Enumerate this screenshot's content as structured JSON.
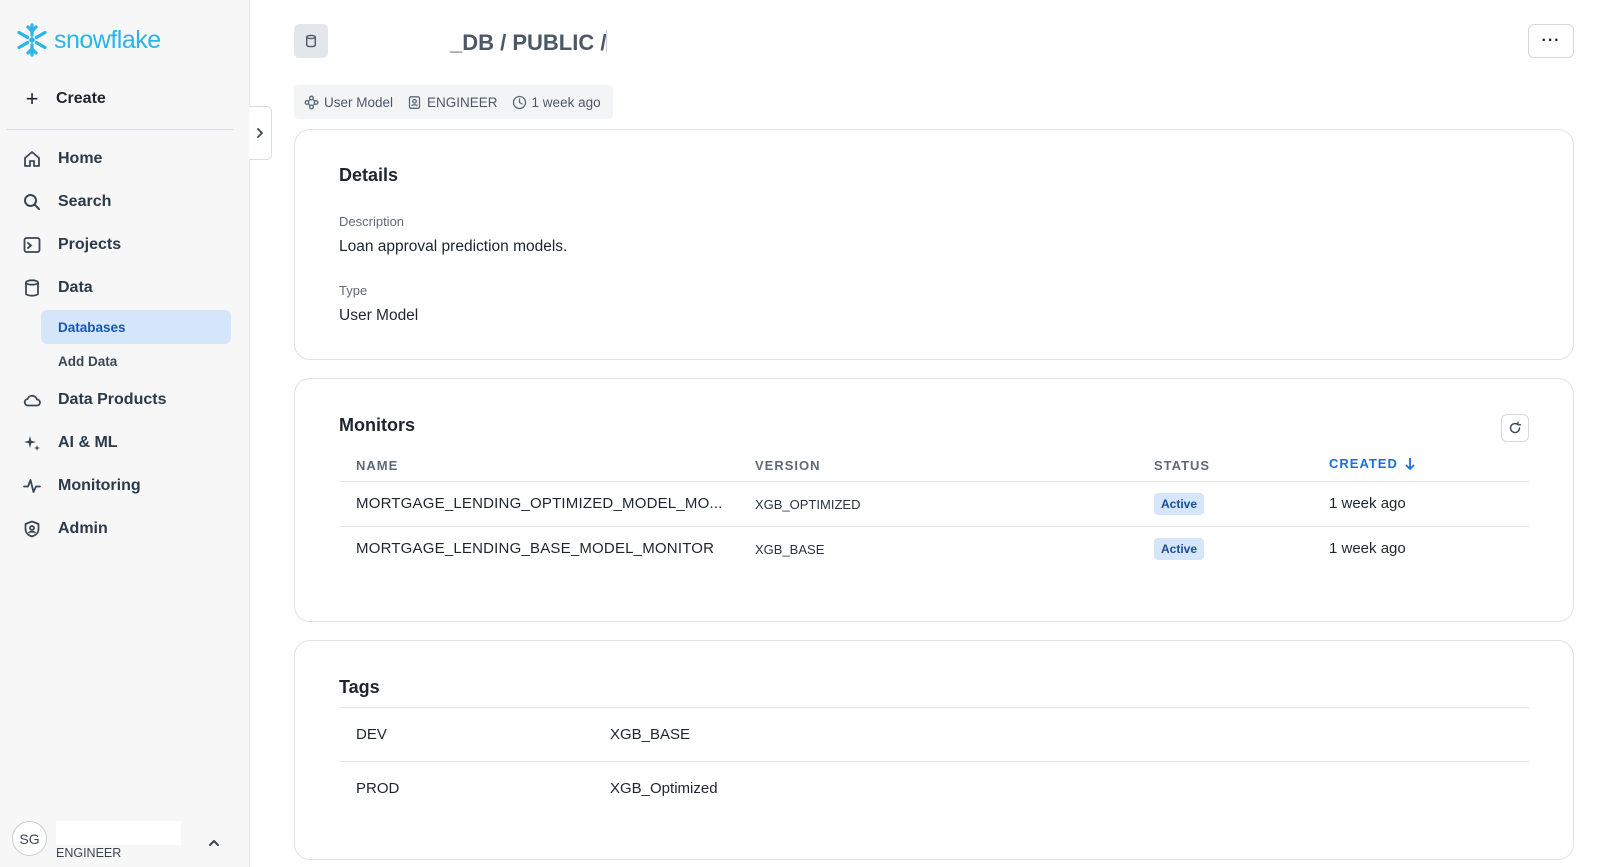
{
  "brand": {
    "logo_text": "snowflake",
    "logo_color": "#29b5e8"
  },
  "sidebar": {
    "create_label": "Create",
    "nav": [
      {
        "label": "Home",
        "icon": "home-icon"
      },
      {
        "label": "Search",
        "icon": "search-icon"
      },
      {
        "label": "Projects",
        "icon": "terminal-icon"
      },
      {
        "label": "Data",
        "icon": "database-icon"
      },
      {
        "label": "Data Products",
        "icon": "cloud-icon"
      },
      {
        "label": "AI & ML",
        "icon": "sparkle-icon"
      },
      {
        "label": "Monitoring",
        "icon": "activity-icon"
      },
      {
        "label": "Admin",
        "icon": "shield-icon"
      }
    ],
    "data_sub": [
      {
        "label": "Databases",
        "active": true
      },
      {
        "label": "Add Data",
        "active": false
      }
    ],
    "user": {
      "initials": "SG",
      "role": "ENGINEER"
    }
  },
  "header": {
    "breadcrumb": "_DB / PUBLIC /",
    "more_label": "···"
  },
  "meta": {
    "type": "User Model",
    "owner": "ENGINEER",
    "created": "1 week ago"
  },
  "details": {
    "title": "Details",
    "description_label": "Description",
    "description": "Loan approval prediction models.",
    "type_label": "Type",
    "type": "User Model"
  },
  "monitors": {
    "title": "Monitors",
    "columns": {
      "name": "NAME",
      "version": "VERSION",
      "status": "STATUS",
      "created": "CREATED"
    },
    "rows": [
      {
        "name": "MORTGAGE_LENDING_OPTIMIZED_MODEL_MO...",
        "version": "XGB_OPTIMIZED",
        "status": "Active",
        "created": "1 week ago"
      },
      {
        "name": "MORTGAGE_LENDING_BASE_MODEL_MONITOR",
        "version": "XGB_BASE",
        "status": "Active",
        "created": "1 week ago"
      }
    ]
  },
  "tags": {
    "title": "Tags",
    "rows": [
      {
        "key": "DEV",
        "value": "XGB_BASE"
      },
      {
        "key": "PROD",
        "value": "XGB_Optimized"
      }
    ]
  },
  "colors": {
    "accent": "#1a6fe0",
    "active_bg": "#d5e5fa",
    "sidebar_bg": "#f7f7f8"
  }
}
